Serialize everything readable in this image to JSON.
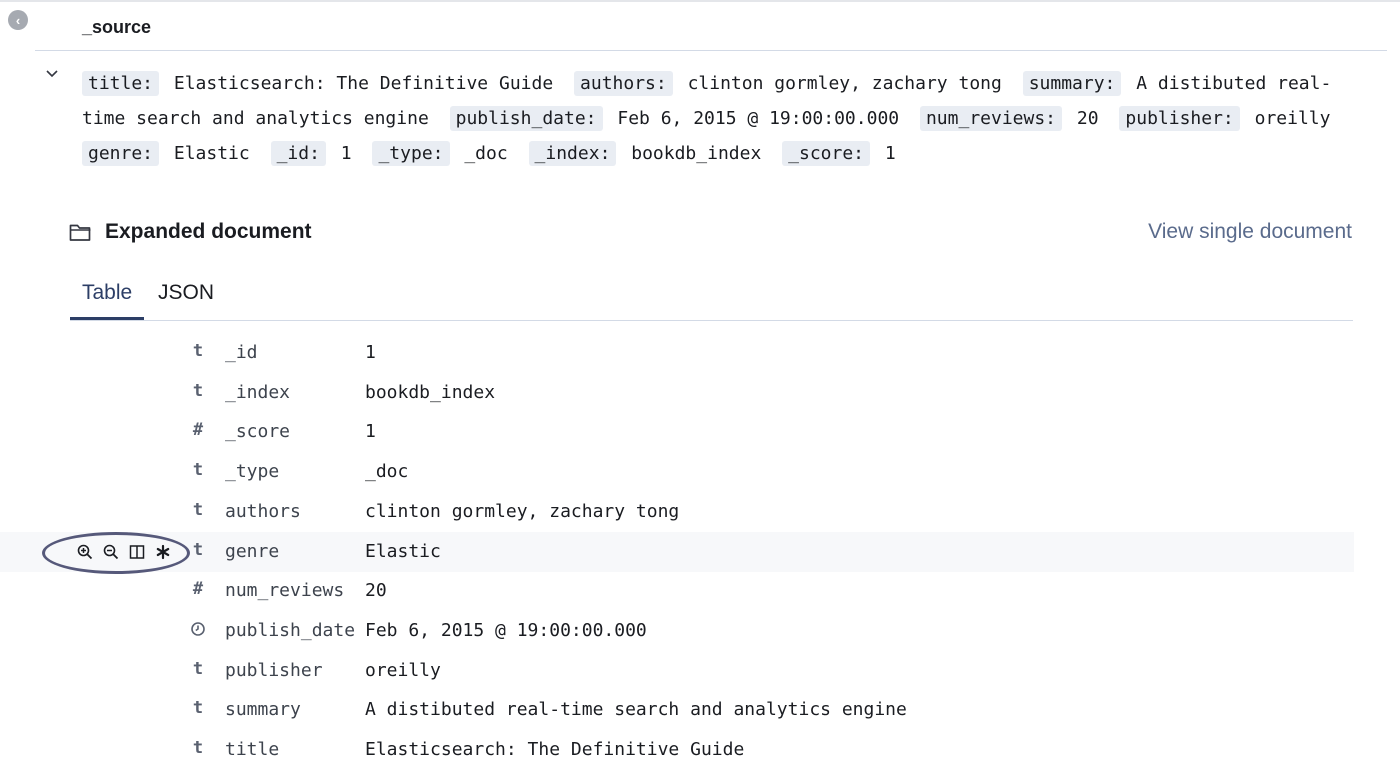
{
  "source_section": {
    "collapse_icon": "chevron-left-circle-icon",
    "header": "_source",
    "row_toggle_icon": "chevron-down-icon",
    "fields": [
      {
        "key": "title:",
        "value": "Elasticsearch: The Definitive Guide"
      },
      {
        "key": "authors:",
        "value": "clinton gormley, zachary tong"
      },
      {
        "key": "summary:",
        "value": "A distibuted real-time search and analytics engine"
      },
      {
        "key": "publish_date:",
        "value": "Feb 6, 2015 @ 19:00:00.000"
      },
      {
        "key": "num_reviews:",
        "value": "20"
      },
      {
        "key": "publisher:",
        "value": "oreilly"
      },
      {
        "key": "genre:",
        "value": "Elastic"
      },
      {
        "key": "_id:",
        "value": "1"
      },
      {
        "key": "_type:",
        "value": "_doc"
      },
      {
        "key": "_index:",
        "value": "bookdb_index"
      },
      {
        "key": "_score:",
        "value": "1"
      }
    ]
  },
  "expanded": {
    "icon": "folder-open-icon",
    "title": "Expanded document",
    "view_single_link": "View single document",
    "tabs": [
      {
        "label": "Table",
        "selected": true
      },
      {
        "label": "JSON",
        "selected": false
      }
    ],
    "rows": [
      {
        "type": "t",
        "field": "_id",
        "value": "1"
      },
      {
        "type": "t",
        "field": "_index",
        "value": "bookdb_index"
      },
      {
        "type": "#",
        "field": "_score",
        "value": "1"
      },
      {
        "type": "t",
        "field": "_type",
        "value": "_doc"
      },
      {
        "type": "t",
        "field": "authors",
        "value": "clinton gormley, zachary tong"
      },
      {
        "type": "t",
        "field": "genre",
        "value": "Elastic",
        "hover": true
      },
      {
        "type": "#",
        "field": "num_reviews",
        "value": "20"
      },
      {
        "type": "clock",
        "field": "publish_date",
        "value": "Feb 6, 2015 @ 19:00:00.000"
      },
      {
        "type": "t",
        "field": "publisher",
        "value": "oreilly"
      },
      {
        "type": "t",
        "field": "summary",
        "value": "A distibuted real-time search and analytics engine"
      },
      {
        "type": "t",
        "field": "title",
        "value": "Elasticsearch: The Definitive Guide"
      }
    ],
    "row_actions": [
      "filter-for-value-icon",
      "filter-out-value-icon",
      "toggle-column-icon",
      "filter-exists-icon"
    ]
  },
  "colors": {
    "accent": "#2c3e66",
    "link": "#5a6b8c",
    "annotation": "#56597a",
    "key_badge": "#e9edf3"
  }
}
